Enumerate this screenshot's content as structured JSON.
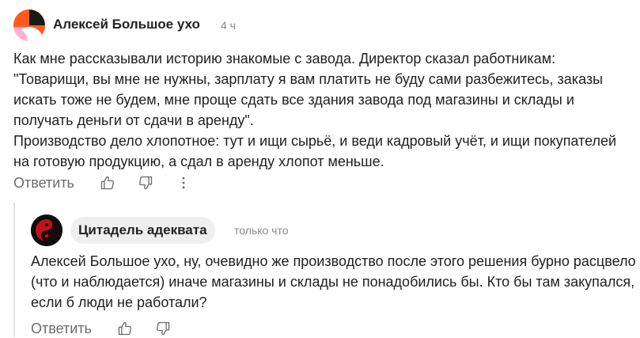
{
  "colors": {
    "text": "#1f1f1f",
    "muted": "#8a8a8a",
    "action": "#6b6b6b",
    "author_pill": "#efefef",
    "thread_line": "#e3e3e3"
  },
  "comment": {
    "author": "Алексей Большое ухо",
    "time": "4 ч",
    "paragraphs": [
      "Как мне рассказывали историю знакомые с завода. Директор сказал работникам: \"Товарищи, вы мне не нужны, зарплату я вам платить не буду сами разбежитесь, заказы искать тоже не будем, мне проще сдать все здания завода под магазины и склады и получать деньги от сдачи в аренду\".",
      "Производство дело хлопотное: тут и ищи сырьё, и веди кадровый учёт, и ищи покупателей на готовую продукцию, а сдал в аренду хлопот меньше."
    ],
    "actions": {
      "reply_label": "Ответить",
      "like_icon": "thumbs-up-icon",
      "dislike_icon": "thumbs-down-icon",
      "more_icon": "more-vertical-icon"
    }
  },
  "reply": {
    "author": "Цитадель адеквата",
    "time": "только что",
    "text": "Алексей Большое ухо, ну, очевидно же производство после этого решения бурно расцвело (что и наблюдается) иначе магазины и склады не понадобились бы. Кто бы там закупался, если б люди не работали?",
    "actions": {
      "reply_label": "Ответить",
      "like_icon": "thumbs-up-icon",
      "dislike_icon": "thumbs-down-icon"
    }
  }
}
